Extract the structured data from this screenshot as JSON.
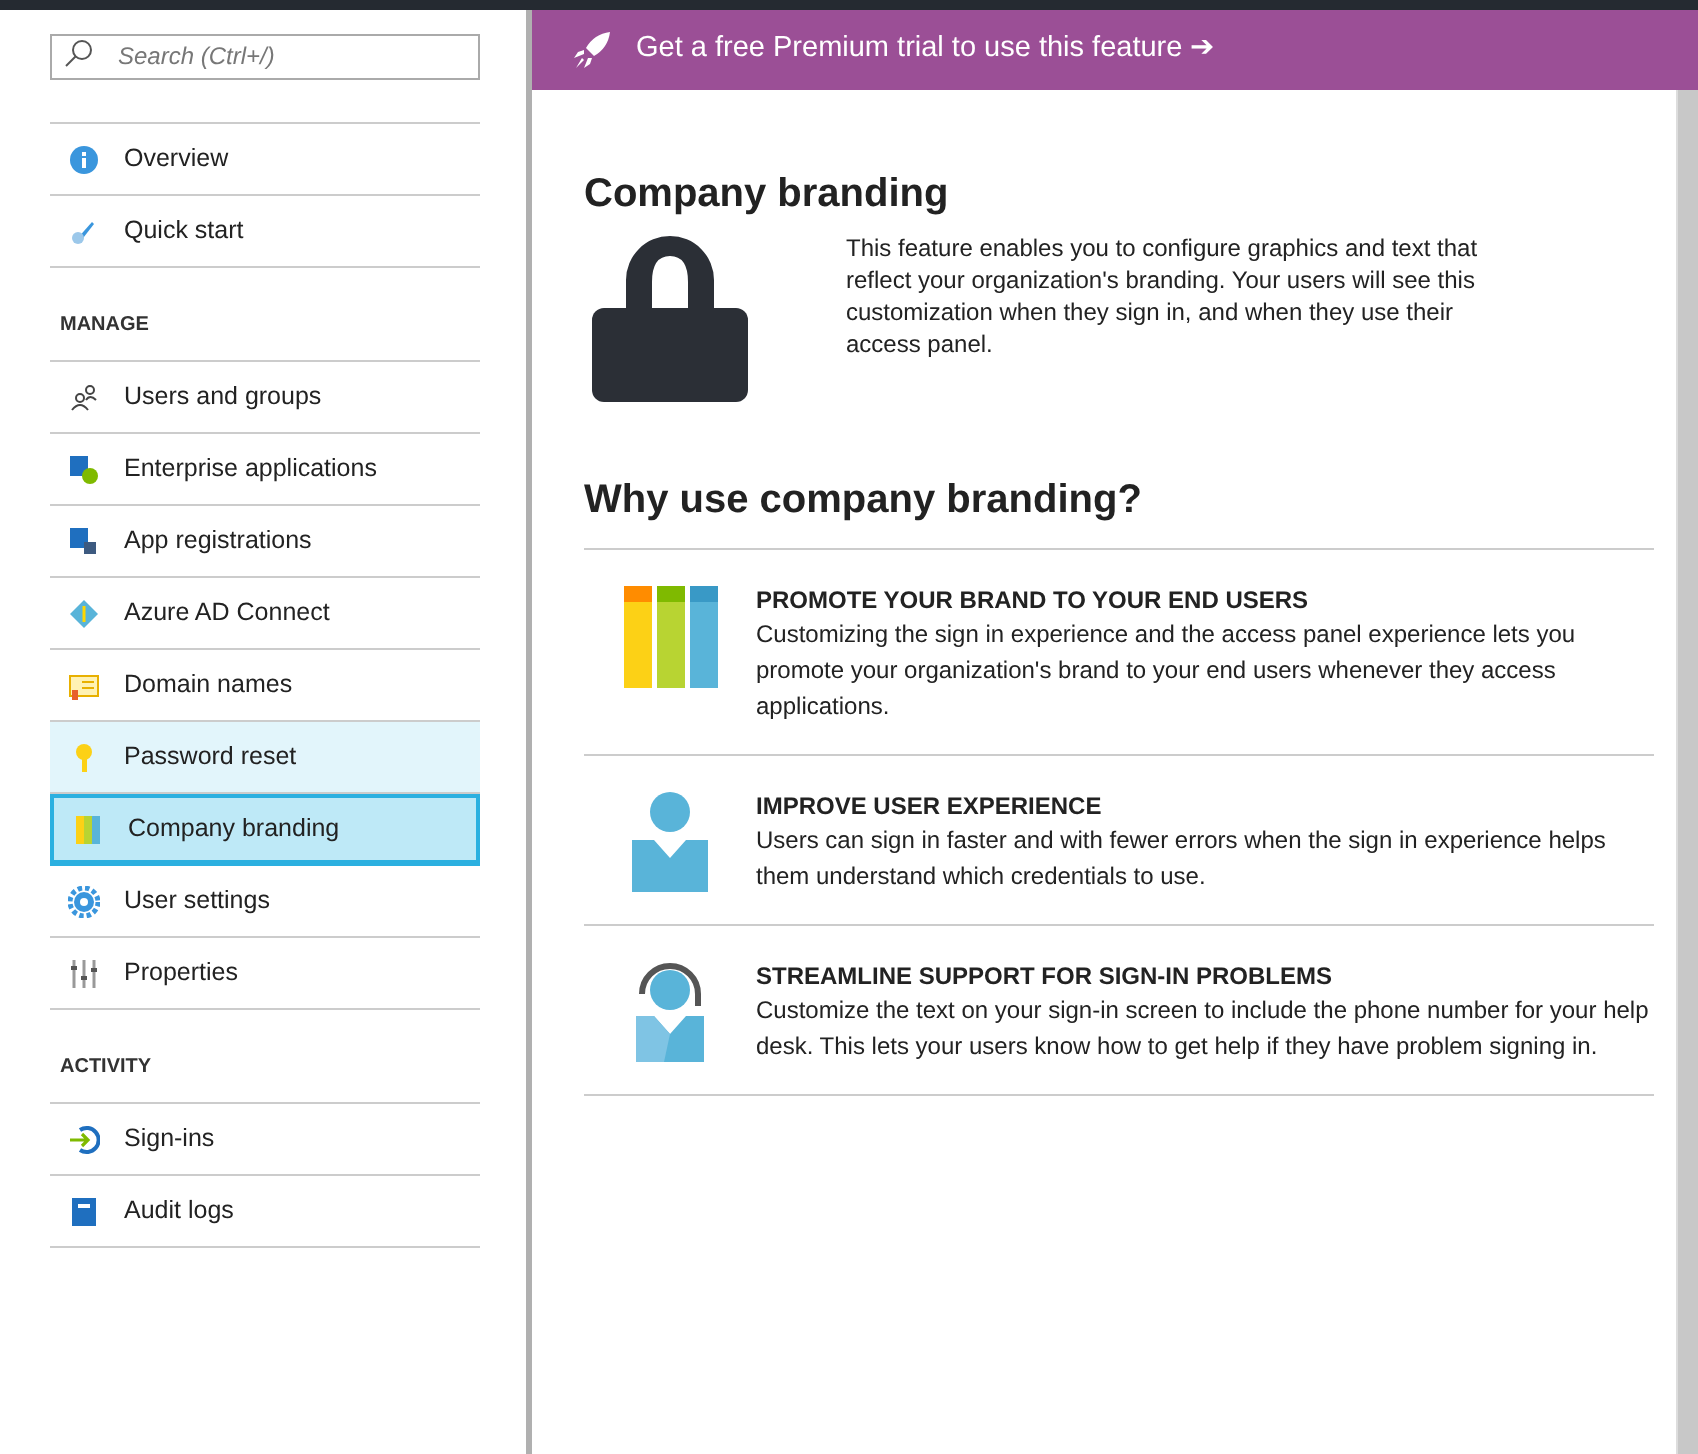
{
  "sidebar": {
    "search": {
      "placeholder": "Search (Ctrl+/)"
    },
    "sections": [
      {
        "items": [
          {
            "label": "Overview",
            "selected": false,
            "hovered": false
          },
          {
            "label": "Quick start",
            "selected": false,
            "hovered": false
          }
        ]
      },
      {
        "heading": "MANAGE",
        "items": [
          {
            "label": "Users and groups",
            "selected": false,
            "hovered": false
          },
          {
            "label": "Enterprise applications",
            "selected": false,
            "hovered": false
          },
          {
            "label": "App registrations",
            "selected": false,
            "hovered": false
          },
          {
            "label": "Azure AD Connect",
            "selected": false,
            "hovered": false
          },
          {
            "label": "Domain names",
            "selected": false,
            "hovered": false
          },
          {
            "label": "Password reset",
            "selected": false,
            "hovered": true
          },
          {
            "label": "Company branding",
            "selected": true,
            "hovered": false
          },
          {
            "label": "User settings",
            "selected": false,
            "hovered": false
          },
          {
            "label": "Properties",
            "selected": false,
            "hovered": false
          }
        ]
      },
      {
        "heading": "ACTIVITY",
        "items": [
          {
            "label": "Sign-ins",
            "selected": false,
            "hovered": false
          },
          {
            "label": "Audit logs",
            "selected": false,
            "hovered": false
          }
        ]
      }
    ]
  },
  "banner": {
    "text": "Get a free Premium trial to use this feature",
    "arrow": "➔"
  },
  "main": {
    "title": "Company branding",
    "description": "This feature enables you to configure graphics and text that reflect your organization's branding. Your users will see this customization when they sign in, and when they use their access panel.",
    "subtitle": "Why use company branding?",
    "features": [
      {
        "title": "PROMOTE YOUR BRAND TO YOUR END USERS",
        "text": "Customizing the sign in experience and the access panel experience lets you promote your organization's brand to your end users whenever they access applications."
      },
      {
        "title": "IMPROVE USER EXPERIENCE",
        "text": "Users can sign in faster and with fewer errors when the sign in experience helps them understand which credentials to use."
      },
      {
        "title": "STREAMLINE SUPPORT FOR SIGN-IN PROBLEMS",
        "text": "Customize the text on your sign-in screen to include the phone number for your help desk. This lets your users know how to get help if they have problem signing in."
      }
    ]
  }
}
